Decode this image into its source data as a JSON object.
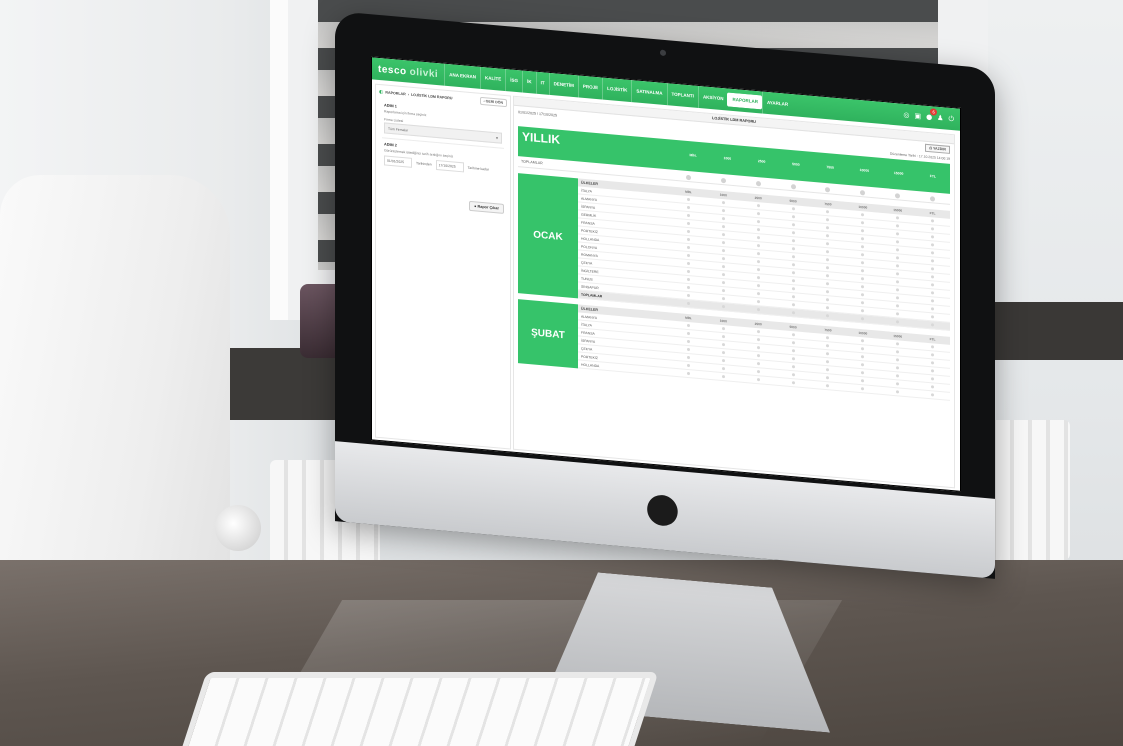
{
  "app": {
    "brand_name": "tesco",
    "brand_sub": "olivki",
    "nav": [
      "ANA EKRAN",
      "KALİTE",
      "İSG",
      "İK",
      "IT",
      "DENETİM",
      "PROJE",
      "LOJİSTİK",
      "SATINALMA",
      "TOPLANTI",
      "AKSİYON",
      "RAPORLAR",
      "AYARLAR"
    ],
    "active_nav": "RAPORLAR",
    "notification_count": "6"
  },
  "left_panel": {
    "breadcrumb_root": "RAPORLAR",
    "breadcrumb_sep": "›",
    "breadcrumb_page": "LOJİSTİK LDM RAPORU",
    "back_label": "‹ GERİ DÖN",
    "step1_title": "ADIM 1",
    "step1_text": "Raporlama için firma seçiniz",
    "firm_label": "Firma Listesi",
    "firm_value": "Tüm Firmalar",
    "step2_title": "ADIM 2",
    "step2_text": "Görüntülemek istediğiniz tarih aralığını seçiniz",
    "date_from": "01/01/2025",
    "date_from_label": "Tarihinden",
    "date_to": "17/10/2025",
    "date_to_label": "Tarihine kadar",
    "report_button": "Rapor Çıkar"
  },
  "content": {
    "report_title": "LOJİSTİK LDM RAPORU",
    "range": "01/01/2025 / 17/10/2025",
    "print_button": "YAZDIR",
    "updated": "Düzenleme Tarihi : 17.10.2025 14:00:19",
    "annual_title": "YILLIK",
    "totals_label": "TOPLAMLAR",
    "value_columns": [
      "MİN.",
      "1000",
      "2500",
      "5000",
      "7500",
      "10000",
      "15000",
      "FTL"
    ],
    "country_header": "ÜLKELER",
    "months": [
      {
        "name": "OCAK",
        "countries": [
          "İTALYA",
          "ALMANYA",
          "İSPANYA",
          "GERMLİK",
          "FRANSA",
          "PORTEKİZ",
          "HOLLANDA",
          "POLONYA",
          "ROMANYA",
          "ÇEKYA",
          "İNGİLTERE",
          "TUNUS",
          "SİNGAPUR"
        ],
        "total_label": "TOPLAMLAR"
      },
      {
        "name": "ŞUBAT",
        "countries": [
          "ALMANYA",
          "İTALYA",
          "FRANSA",
          "İSPANYA",
          "ÇEKYA",
          "PORTEKİZ",
          "HOLLANDA"
        ],
        "total_label": ""
      }
    ]
  },
  "colors": {
    "accent": "#36c36a",
    "topbar": "#2fb25d",
    "badge": "#e53935",
    "chat": "#2f7ce0"
  },
  "icons": [
    "report-icon",
    "grid-icon",
    "bell-icon",
    "user-icon",
    "power-icon",
    "chat-icon",
    "apple-logo-icon",
    "chevron-down-icon",
    "printer-icon"
  ]
}
